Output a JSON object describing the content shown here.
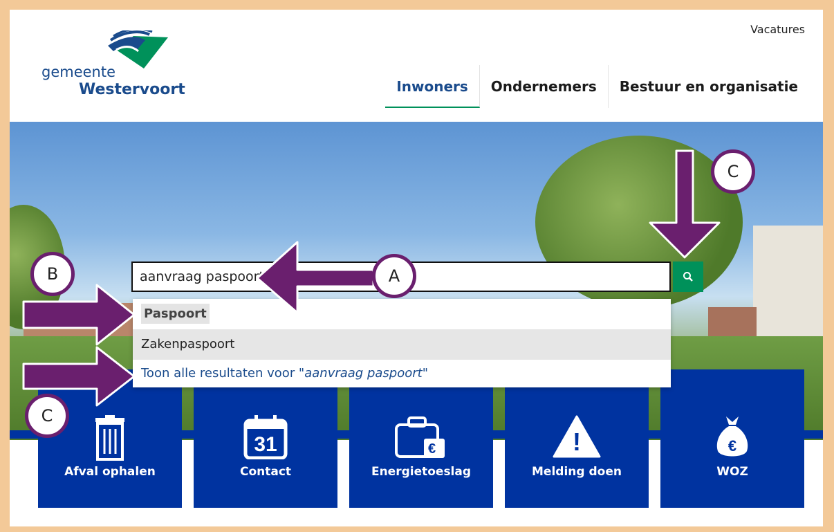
{
  "header": {
    "top_link": "Vacatures",
    "logo": {
      "line1": "gemeente",
      "line2": "Westervoort"
    },
    "nav": [
      {
        "label": "Inwoners",
        "active": true
      },
      {
        "label": "Ondernemers",
        "active": false
      },
      {
        "label": "Bestuur en organisatie",
        "active": false
      }
    ]
  },
  "search": {
    "value": "aanvraag paspoort",
    "button_icon": "search-icon",
    "suggestions": [
      {
        "label": "Paspoort"
      },
      {
        "label": "Zakenpaspoort"
      }
    ],
    "show_all_prefix": "Toon alle resultaten voor \"",
    "show_all_query": "aanvraag paspoort",
    "show_all_suffix": "\""
  },
  "tiles": [
    {
      "label": "Afval ophalen",
      "icon": "trash-bin-icon"
    },
    {
      "label": "Contact",
      "icon": "calendar-icon",
      "icon_text": "31"
    },
    {
      "label": "Energietoeslag",
      "icon": "briefcase-euro-icon",
      "icon_text": "€"
    },
    {
      "label": "Melding doen",
      "icon": "warning-icon",
      "icon_text": "!"
    },
    {
      "label": "WOZ",
      "icon": "money-bag-icon",
      "icon_text": "€"
    }
  ],
  "annotations": {
    "a": "A",
    "b": "B",
    "c_top": "C",
    "c_bottom": "C"
  },
  "colors": {
    "brand_blue": "#0033a0",
    "green": "#00915a",
    "annotation_purple": "#6a1f6e",
    "frame": "#f3c998"
  }
}
